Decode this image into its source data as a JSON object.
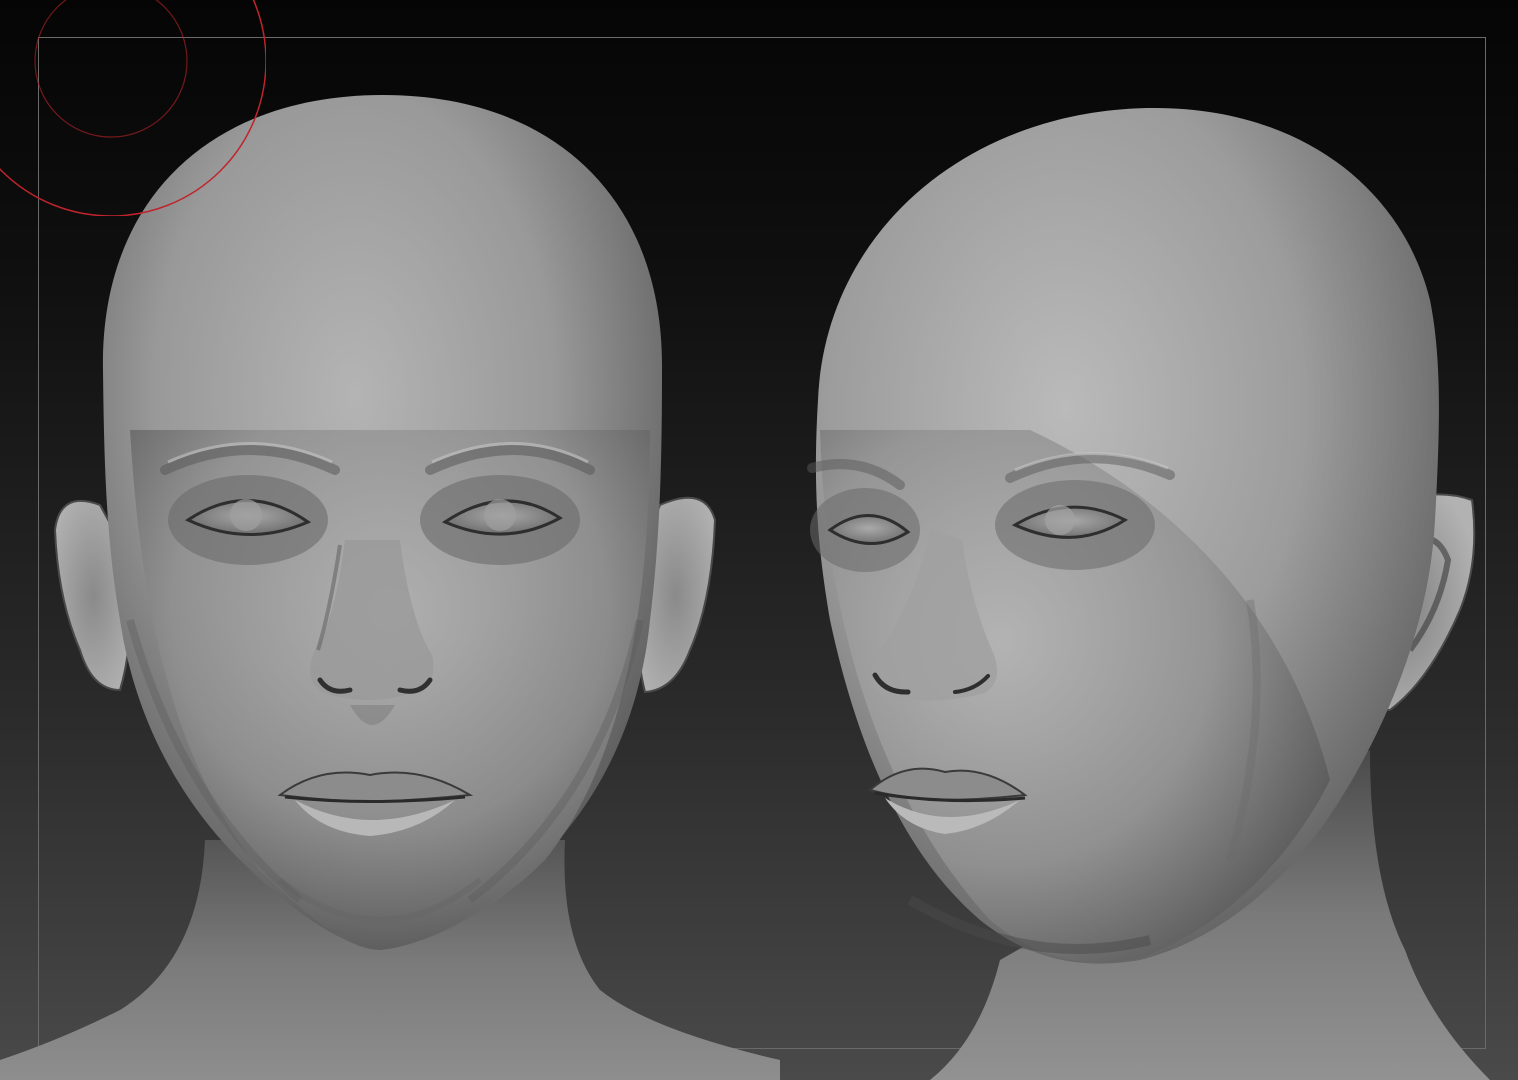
{
  "viewport": {
    "background_top": "#050505",
    "background_bottom": "#4a4a4a",
    "frame_color": "#6a6a6a"
  },
  "models": [
    {
      "view": "front",
      "material": "matcap-gray",
      "base_color": "#9a9a9a"
    },
    {
      "view": "three-quarter",
      "material": "matcap-gray",
      "base_color": "#9a9a9a"
    }
  ],
  "brush_cursor": {
    "color": "#c0242c",
    "outer_icon": "brush-draw-size-ring",
    "inner_icon": "brush-focal-ring"
  }
}
